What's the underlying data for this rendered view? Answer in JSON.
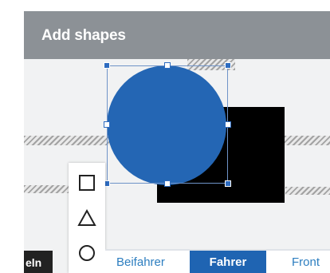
{
  "header": {
    "title": "Add shapes"
  },
  "canvas": {
    "circle_color": "#2466b4",
    "rect_color": "#000000"
  },
  "toolbar": {
    "tools": [
      {
        "name": "square",
        "icon": "square-icon"
      },
      {
        "name": "triangle",
        "icon": "triangle-icon"
      },
      {
        "name": "circle",
        "icon": "circle-icon"
      }
    ]
  },
  "left_badge": {
    "label": "eln"
  },
  "tabs": [
    {
      "label": "Beifahrer",
      "active": false
    },
    {
      "label": "Fahrer",
      "active": true
    },
    {
      "label": "Front",
      "active": false
    }
  ],
  "colors": {
    "accent": "#1f64b2",
    "header_bg": "#8c9196",
    "tab_text": "#2d7ec0"
  }
}
